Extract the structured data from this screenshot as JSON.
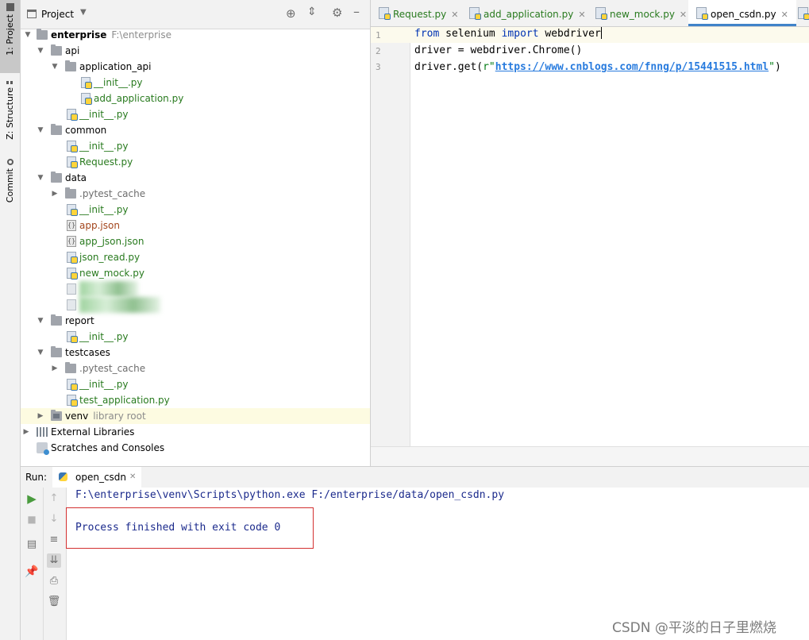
{
  "tool_strip": {
    "tabs": [
      {
        "label": "1: Project"
      },
      {
        "label": "Z: Structure"
      },
      {
        "label": "Commit"
      }
    ]
  },
  "project_panel": {
    "title": "Project",
    "tree": [
      {
        "label": "enterprise",
        "hint": "F:\\enterprise"
      },
      {
        "label": "api"
      },
      {
        "label": "application_api"
      },
      {
        "label": "__init__.py"
      },
      {
        "label": "add_application.py"
      },
      {
        "label": "__init__.py"
      },
      {
        "label": "common"
      },
      {
        "label": "__init__.py"
      },
      {
        "label": "Request.py"
      },
      {
        "label": "data"
      },
      {
        "label": ".pytest_cache"
      },
      {
        "label": "__init__.py"
      },
      {
        "label": "app.json"
      },
      {
        "label": "app_json.json"
      },
      {
        "label": "json_read.py"
      },
      {
        "label": "new_mock.py"
      },
      {
        "label": "████████"
      },
      {
        "label": "███████████"
      },
      {
        "label": "report"
      },
      {
        "label": "__init__.py"
      },
      {
        "label": "testcases"
      },
      {
        "label": ".pytest_cache"
      },
      {
        "label": "__init__.py"
      },
      {
        "label": "test_application.py"
      },
      {
        "label": "venv",
        "hint": "library root"
      },
      {
        "label": "External Libraries"
      },
      {
        "label": "Scratches and Consoles"
      }
    ]
  },
  "editor": {
    "tabs": [
      {
        "label": "Request.py"
      },
      {
        "label": "add_application.py"
      },
      {
        "label": "new_mock.py"
      },
      {
        "label": "open_csdn.py"
      }
    ],
    "line_numbers": [
      "1",
      "2",
      "3"
    ],
    "code": {
      "l1_kw1": "from",
      "l1_mod": " selenium ",
      "l1_kw2": "import",
      "l1_name": " webdriver",
      "l2": "driver = webdriver.Chrome()",
      "l3_pre": "driver.get(",
      "l3_str_open": "r\"",
      "l3_url": "https://www.cnblogs.com/fnng/p/15441515.html",
      "l3_str_close": "\"",
      "l3_post": ")"
    }
  },
  "run_panel": {
    "label": "Run:",
    "tab": "open_csdn",
    "console": [
      "F:\\enterprise\\venv\\Scripts\\python.exe F:/enterprise/data/open_csdn.py",
      "Process finished with exit code 0"
    ]
  },
  "watermark": "CSDN @平淡的日子里燃烧"
}
